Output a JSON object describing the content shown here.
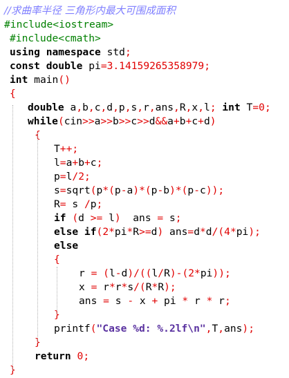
{
  "code_lines": [
    [
      {
        "t": "//求曲率半径 三角形内最大可围成面积",
        "c": "com"
      }
    ],
    [
      {
        "t": "#include<iostream>",
        "c": "pp"
      }
    ],
    [
      {
        "t": "#include<cmath>",
        "c": "pp"
      }
    ],
    [
      {
        "t": "using namespace ",
        "c": "kw"
      },
      {
        "t": "std",
        "c": "plain"
      },
      {
        "t": ";",
        "c": "op"
      }
    ],
    [
      {
        "t": "const double ",
        "c": "kw"
      },
      {
        "t": "pi",
        "c": "plain"
      },
      {
        "t": "=",
        "c": "op"
      },
      {
        "t": "3.14159265358979",
        "c": "num"
      },
      {
        "t": ";",
        "c": "op"
      }
    ],
    [
      {
        "t": "int ",
        "c": "kw"
      },
      {
        "t": "main",
        "c": "plain"
      },
      {
        "t": "()",
        "c": "op"
      }
    ],
    [
      {
        "t": "{",
        "c": "op"
      }
    ],
    [
      {
        "t": "double ",
        "c": "kw"
      },
      {
        "t": "a",
        "c": "plain"
      },
      {
        "t": ",",
        "c": "op"
      },
      {
        "t": "b",
        "c": "plain"
      },
      {
        "t": ",",
        "c": "op"
      },
      {
        "t": "c",
        "c": "plain"
      },
      {
        "t": ",",
        "c": "op"
      },
      {
        "t": "d",
        "c": "plain"
      },
      {
        "t": ",",
        "c": "op"
      },
      {
        "t": "p",
        "c": "plain"
      },
      {
        "t": ",",
        "c": "op"
      },
      {
        "t": "s",
        "c": "plain"
      },
      {
        "t": ",",
        "c": "op"
      },
      {
        "t": "r",
        "c": "plain"
      },
      {
        "t": ",",
        "c": "op"
      },
      {
        "t": "ans",
        "c": "plain"
      },
      {
        "t": ",",
        "c": "op"
      },
      {
        "t": "R",
        "c": "plain"
      },
      {
        "t": ",",
        "c": "op"
      },
      {
        "t": "x",
        "c": "plain"
      },
      {
        "t": ",",
        "c": "op"
      },
      {
        "t": "l",
        "c": "plain"
      },
      {
        "t": "; ",
        "c": "op"
      },
      {
        "t": "int ",
        "c": "kw"
      },
      {
        "t": "T",
        "c": "plain"
      },
      {
        "t": "=",
        "c": "op"
      },
      {
        "t": "0",
        "c": "num"
      },
      {
        "t": ";",
        "c": "op"
      }
    ],
    [
      {
        "t": "while",
        "c": "kw"
      },
      {
        "t": "(",
        "c": "op"
      },
      {
        "t": "cin",
        "c": "plain"
      },
      {
        "t": ">>",
        "c": "op"
      },
      {
        "t": "a",
        "c": "plain"
      },
      {
        "t": ">>",
        "c": "op"
      },
      {
        "t": "b",
        "c": "plain"
      },
      {
        "t": ">>",
        "c": "op"
      },
      {
        "t": "c",
        "c": "plain"
      },
      {
        "t": ">>",
        "c": "op"
      },
      {
        "t": "d",
        "c": "plain"
      },
      {
        "t": "&&",
        "c": "op"
      },
      {
        "t": "a",
        "c": "plain"
      },
      {
        "t": "+",
        "c": "op"
      },
      {
        "t": "b",
        "c": "plain"
      },
      {
        "t": "+",
        "c": "op"
      },
      {
        "t": "c",
        "c": "plain"
      },
      {
        "t": "+",
        "c": "op"
      },
      {
        "t": "d",
        "c": "plain"
      },
      {
        "t": ")",
        "c": "op"
      }
    ],
    [
      {
        "t": "{",
        "c": "op"
      }
    ],
    [
      {
        "t": "T",
        "c": "plain"
      },
      {
        "t": "++;",
        "c": "op"
      }
    ],
    [
      {
        "t": "l",
        "c": "plain"
      },
      {
        "t": "=",
        "c": "op"
      },
      {
        "t": "a",
        "c": "plain"
      },
      {
        "t": "+",
        "c": "op"
      },
      {
        "t": "b",
        "c": "plain"
      },
      {
        "t": "+",
        "c": "op"
      },
      {
        "t": "c",
        "c": "plain"
      },
      {
        "t": ";",
        "c": "op"
      }
    ],
    [
      {
        "t": "p",
        "c": "plain"
      },
      {
        "t": "=",
        "c": "op"
      },
      {
        "t": "l",
        "c": "plain"
      },
      {
        "t": "/",
        "c": "op"
      },
      {
        "t": "2",
        "c": "num"
      },
      {
        "t": ";",
        "c": "op"
      }
    ],
    [
      {
        "t": "s",
        "c": "plain"
      },
      {
        "t": "=",
        "c": "op"
      },
      {
        "t": "sqrt",
        "c": "plain"
      },
      {
        "t": "(",
        "c": "op"
      },
      {
        "t": "p",
        "c": "plain"
      },
      {
        "t": "*(",
        "c": "op"
      },
      {
        "t": "p",
        "c": "plain"
      },
      {
        "t": "-",
        "c": "op"
      },
      {
        "t": "a",
        "c": "plain"
      },
      {
        "t": ")*(",
        "c": "op"
      },
      {
        "t": "p",
        "c": "plain"
      },
      {
        "t": "-",
        "c": "op"
      },
      {
        "t": "b",
        "c": "plain"
      },
      {
        "t": ")*(",
        "c": "op"
      },
      {
        "t": "p",
        "c": "plain"
      },
      {
        "t": "-",
        "c": "op"
      },
      {
        "t": "c",
        "c": "plain"
      },
      {
        "t": "));",
        "c": "op"
      }
    ],
    [
      {
        "t": "R",
        "c": "plain"
      },
      {
        "t": "= ",
        "c": "op"
      },
      {
        "t": "s ",
        "c": "plain"
      },
      {
        "t": "/",
        "c": "op"
      },
      {
        "t": "p",
        "c": "plain"
      },
      {
        "t": ";",
        "c": "op"
      }
    ],
    [
      {
        "t": "if ",
        "c": "kw"
      },
      {
        "t": "(",
        "c": "op"
      },
      {
        "t": "d ",
        "c": "plain"
      },
      {
        "t": ">= ",
        "c": "op"
      },
      {
        "t": "l",
        "c": "plain"
      },
      {
        "t": ")  ",
        "c": "op"
      },
      {
        "t": "ans ",
        "c": "plain"
      },
      {
        "t": "= ",
        "c": "op"
      },
      {
        "t": "s",
        "c": "plain"
      },
      {
        "t": ";",
        "c": "op"
      }
    ],
    [
      {
        "t": "else if",
        "c": "kw"
      },
      {
        "t": "(",
        "c": "op"
      },
      {
        "t": "2",
        "c": "num"
      },
      {
        "t": "*",
        "c": "op"
      },
      {
        "t": "pi",
        "c": "plain"
      },
      {
        "t": "*",
        "c": "op"
      },
      {
        "t": "R",
        "c": "plain"
      },
      {
        "t": ">=",
        "c": "op"
      },
      {
        "t": "d",
        "c": "plain"
      },
      {
        "t": ") ",
        "c": "op"
      },
      {
        "t": "ans",
        "c": "plain"
      },
      {
        "t": "=",
        "c": "op"
      },
      {
        "t": "d",
        "c": "plain"
      },
      {
        "t": "*",
        "c": "op"
      },
      {
        "t": "d",
        "c": "plain"
      },
      {
        "t": "/(",
        "c": "op"
      },
      {
        "t": "4",
        "c": "num"
      },
      {
        "t": "*",
        "c": "op"
      },
      {
        "t": "pi",
        "c": "plain"
      },
      {
        "t": ");",
        "c": "op"
      }
    ],
    [
      {
        "t": "else",
        "c": "kw"
      }
    ],
    [
      {
        "t": "{",
        "c": "op"
      }
    ],
    [
      {
        "t": "r ",
        "c": "plain"
      },
      {
        "t": "= (",
        "c": "op"
      },
      {
        "t": "l",
        "c": "plain"
      },
      {
        "t": "-",
        "c": "op"
      },
      {
        "t": "d",
        "c": "plain"
      },
      {
        "t": ")/((",
        "c": "op"
      },
      {
        "t": "l",
        "c": "plain"
      },
      {
        "t": "/",
        "c": "op"
      },
      {
        "t": "R",
        "c": "plain"
      },
      {
        "t": ")-(",
        "c": "op"
      },
      {
        "t": "2",
        "c": "num"
      },
      {
        "t": "*",
        "c": "op"
      },
      {
        "t": "pi",
        "c": "plain"
      },
      {
        "t": "));",
        "c": "op"
      }
    ],
    [
      {
        "t": "x ",
        "c": "plain"
      },
      {
        "t": "= ",
        "c": "op"
      },
      {
        "t": "r",
        "c": "plain"
      },
      {
        "t": "*",
        "c": "op"
      },
      {
        "t": "r",
        "c": "plain"
      },
      {
        "t": "*",
        "c": "op"
      },
      {
        "t": "s",
        "c": "plain"
      },
      {
        "t": "/(",
        "c": "op"
      },
      {
        "t": "R",
        "c": "plain"
      },
      {
        "t": "*",
        "c": "op"
      },
      {
        "t": "R",
        "c": "plain"
      },
      {
        "t": ");",
        "c": "op"
      }
    ],
    [
      {
        "t": "ans ",
        "c": "plain"
      },
      {
        "t": "= ",
        "c": "op"
      },
      {
        "t": "s ",
        "c": "plain"
      },
      {
        "t": "- ",
        "c": "op"
      },
      {
        "t": "x ",
        "c": "plain"
      },
      {
        "t": "+ ",
        "c": "op"
      },
      {
        "t": "pi ",
        "c": "plain"
      },
      {
        "t": "* ",
        "c": "op"
      },
      {
        "t": "r ",
        "c": "plain"
      },
      {
        "t": "* ",
        "c": "op"
      },
      {
        "t": "r",
        "c": "plain"
      },
      {
        "t": ";",
        "c": "op"
      }
    ],
    [
      {
        "t": "}",
        "c": "op"
      }
    ],
    [
      {
        "t": "printf",
        "c": "plain"
      },
      {
        "t": "(",
        "c": "op"
      },
      {
        "t": "\"Case %d: %.2lf\\n\"",
        "c": "str"
      },
      {
        "t": ",",
        "c": "op"
      },
      {
        "t": "T",
        "c": "plain"
      },
      {
        "t": ",",
        "c": "op"
      },
      {
        "t": "ans",
        "c": "plain"
      },
      {
        "t": ");",
        "c": "op"
      }
    ],
    [
      {
        "t": "}",
        "c": "op"
      }
    ],
    [
      {
        "t": "return ",
        "c": "kw"
      },
      {
        "t": "0",
        "c": "num"
      },
      {
        "t": ";",
        "c": "op"
      }
    ],
    [
      {
        "t": "}",
        "c": "op"
      }
    ]
  ],
  "colors": {
    "keyword": "#000000",
    "operator": "#e00000",
    "number": "#e00000",
    "preprocessor": "#008000",
    "comment": "#8080ff",
    "string": "#5a32a0",
    "guide": "#b0b0b0"
  }
}
